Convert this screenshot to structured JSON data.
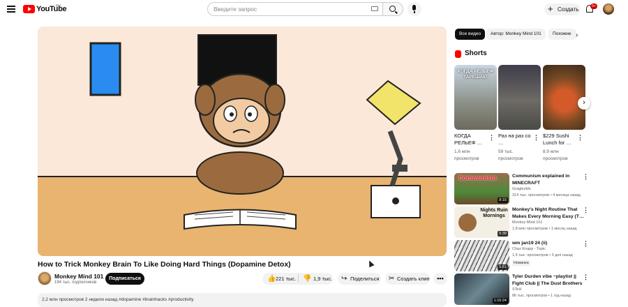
{
  "header": {
    "logo_text": "YouTube",
    "region": "RU",
    "search_placeholder": "Введите запрос",
    "create_label": "Создать",
    "notifications_badge": "9+"
  },
  "video": {
    "title": "How to Trick Monkey Brain To Like Doing Hard Things (Dopamine Detox)",
    "channel_name": "Monkey Mind 101",
    "channel_subs": "194 тыс. подписчиков",
    "subscribe_label": "Подписаться",
    "likes": "221 тыс.",
    "dislikes": "1,9 тыс.",
    "share_label": "Поделиться",
    "clip_label": "Создать клип",
    "description_preview": "2,2 млн просмотров  2 недели назад  #dopamine #brainhacks #productivity"
  },
  "chips": [
    {
      "label": "Все видео",
      "active": true
    },
    {
      "label": "Автор: Monkey Mind 101",
      "active": false
    },
    {
      "label": "Похожие",
      "active": false
    }
  ],
  "shorts": {
    "heading": "Shorts",
    "items": [
      {
        "title": "КОГДА РЕЛЬЕФ …",
        "views": "1,6 млн просмотров",
        "thumb_text": "КОГДА РЕЛЬЕФ ТАРЕШАЕ!"
      },
      {
        "title": "Раз на раз со …",
        "views": "59 тыс. просмотров"
      },
      {
        "title": "$229 Sushi Lunch for …",
        "views": "8,9 млн просмотров"
      }
    ]
  },
  "recommendations": [
    {
      "title": "Communism explained in MINECRAFT",
      "channel": "Gragbuilds",
      "meta": "314 тыс. просмотров • 4 месяца назад",
      "duration": "8:15",
      "thumb_text": "Communism"
    },
    {
      "title": "Monkey's Night Routine That Makes Every Morning Easy (T…",
      "channel": "Monkey Mind 101",
      "meta": "1,8 млн просмотров • 1 месяц назад",
      "duration": "5:39",
      "thumb_text": "Nights Ruin Mornings"
    },
    {
      "title": "wm jan19 24 (ii)",
      "channel": "Chaz Knapp - Topic",
      "meta": "1,9 тыс. просмотров • 3 дня назад",
      "duration": "5:51",
      "badge": "Новинка"
    },
    {
      "title": "Tyler Durden vibe ~playlist || Fight Club || The Dust Brothers",
      "channel": "STeH",
      "meta": "86 тыс. просмотров • 1 год назад",
      "duration": "1:15:24"
    }
  ]
}
